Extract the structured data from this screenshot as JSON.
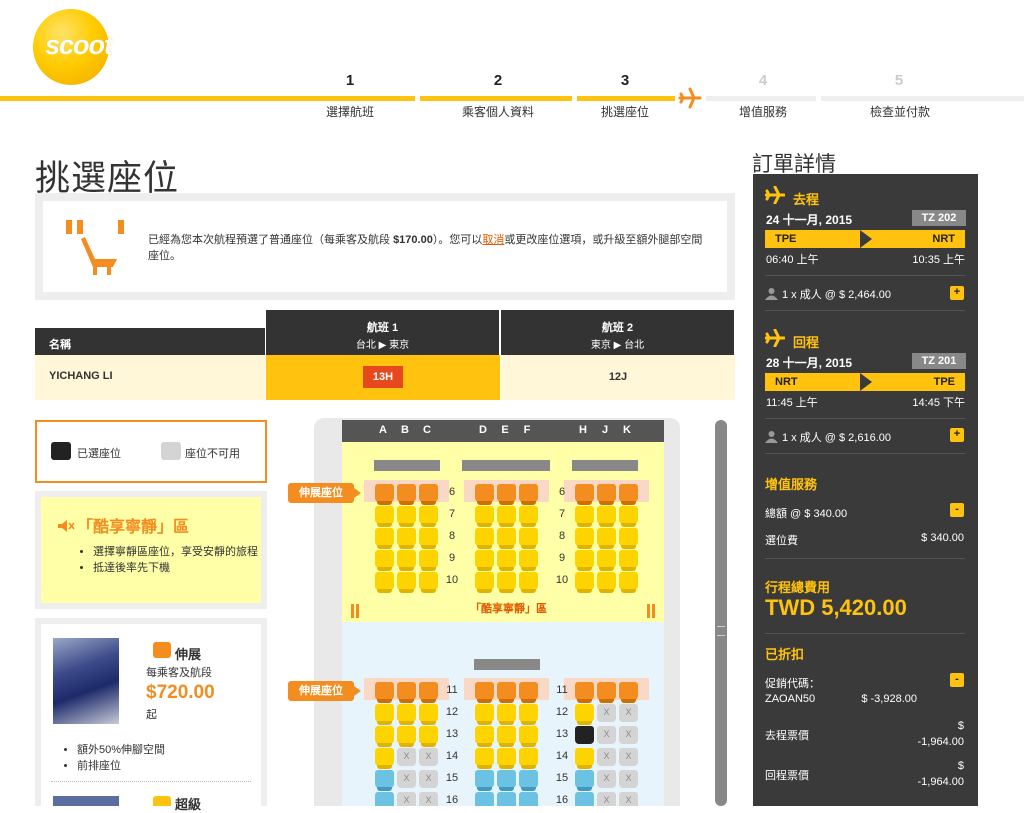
{
  "brand": {
    "logo_text": "scoot",
    "accent": "#ffc20e",
    "orange": "#f38d1f"
  },
  "steps": [
    {
      "num": "1",
      "label": "選擇航班",
      "state": "done"
    },
    {
      "num": "2",
      "label": "乘客個人資料",
      "state": "done"
    },
    {
      "num": "3",
      "label": "挑選座位",
      "state": "current"
    },
    {
      "num": "4",
      "label": "增值服務",
      "state": "upcoming"
    },
    {
      "num": "5",
      "label": "檢查並付款",
      "state": "upcoming"
    }
  ],
  "page": {
    "title": "挑選座位"
  },
  "info": {
    "text_1": "已經為您本次航程預選了普通座位（每乘客及航段 ",
    "price": "$170.00",
    "text_2": "）。您可以",
    "link": "取消",
    "text_3": "或更改座位選項，或升級至額外腿部空間座位。"
  },
  "passengers": {
    "name_header": "名稱",
    "flights": [
      {
        "title": "航班 1",
        "route": "台北 ▶ 東京"
      },
      {
        "title": "航班 2",
        "route": "東京 ▶ 台北"
      }
    ],
    "rows": [
      {
        "name": "YICHANG LI",
        "seat_1": "13H",
        "seat_2": "12J"
      }
    ]
  },
  "legend": {
    "selected": "已選座位",
    "unavailable": "座位不可用"
  },
  "quiet_zone": {
    "title": "「酷享寧靜」區",
    "bullets": [
      "選擇寧靜區座位，享受安靜的旅程",
      "抵達後率先下機"
    ]
  },
  "stretch": {
    "title": "伸展",
    "sub": "每乘客及航段",
    "price": "$720.00",
    "from": "起",
    "bullets": [
      "額外50%伸腳空間",
      "前排座位"
    ],
    "next_title": "超級"
  },
  "seat_map": {
    "columns_left": [
      "A",
      "B",
      "C"
    ],
    "columns_mid": [
      "D",
      "E",
      "F"
    ],
    "columns_right": [
      "H",
      "J",
      "K"
    ],
    "stretch_tag": "伸展座位",
    "quiet_label": "「酷享寧靜」區",
    "rows_zone1": [
      "6",
      "7",
      "8",
      "9",
      "10"
    ],
    "rows_zone2": [
      "11",
      "12",
      "13",
      "14",
      "15",
      "16"
    ],
    "na_mark": "X"
  },
  "summary": {
    "title": "訂單詳情",
    "outbound": {
      "label": "去程",
      "date": "24 十一月, 2015",
      "flight": "TZ 202",
      "from": "TPE",
      "to": "NRT",
      "dep": "06:40 上午",
      "arr": "10:35 上午",
      "pax": "1 x 成人 @ $ 2,464.00"
    },
    "inbound": {
      "label": "回程",
      "date": "28 十一月, 2015",
      "flight": "TZ 201",
      "from": "NRT",
      "to": "TPE",
      "dep": "11:45 上午",
      "arr": "14:45 下午",
      "pax": "1 x 成人 @ $ 2,616.00"
    },
    "addons": {
      "label": "增值服務",
      "total_label": "總額 @ $ 340.00",
      "seat_label": "選位費",
      "seat_value": "$ 340.00"
    },
    "total": {
      "label": "行程總費用",
      "value": "TWD 5,420.00"
    },
    "discount": {
      "label": "已折扣",
      "promo_label": "促銷代碼：",
      "promo_code": "ZAOAN50",
      "promo_value": "$ -3,928.00",
      "out_label": "去程票價",
      "out_value_1": "$",
      "out_value_2": "-1,964.00",
      "in_label": "回程票價",
      "in_value_1": "$",
      "in_value_2": "-1,964.00"
    },
    "plus": "+",
    "minus": "-"
  }
}
